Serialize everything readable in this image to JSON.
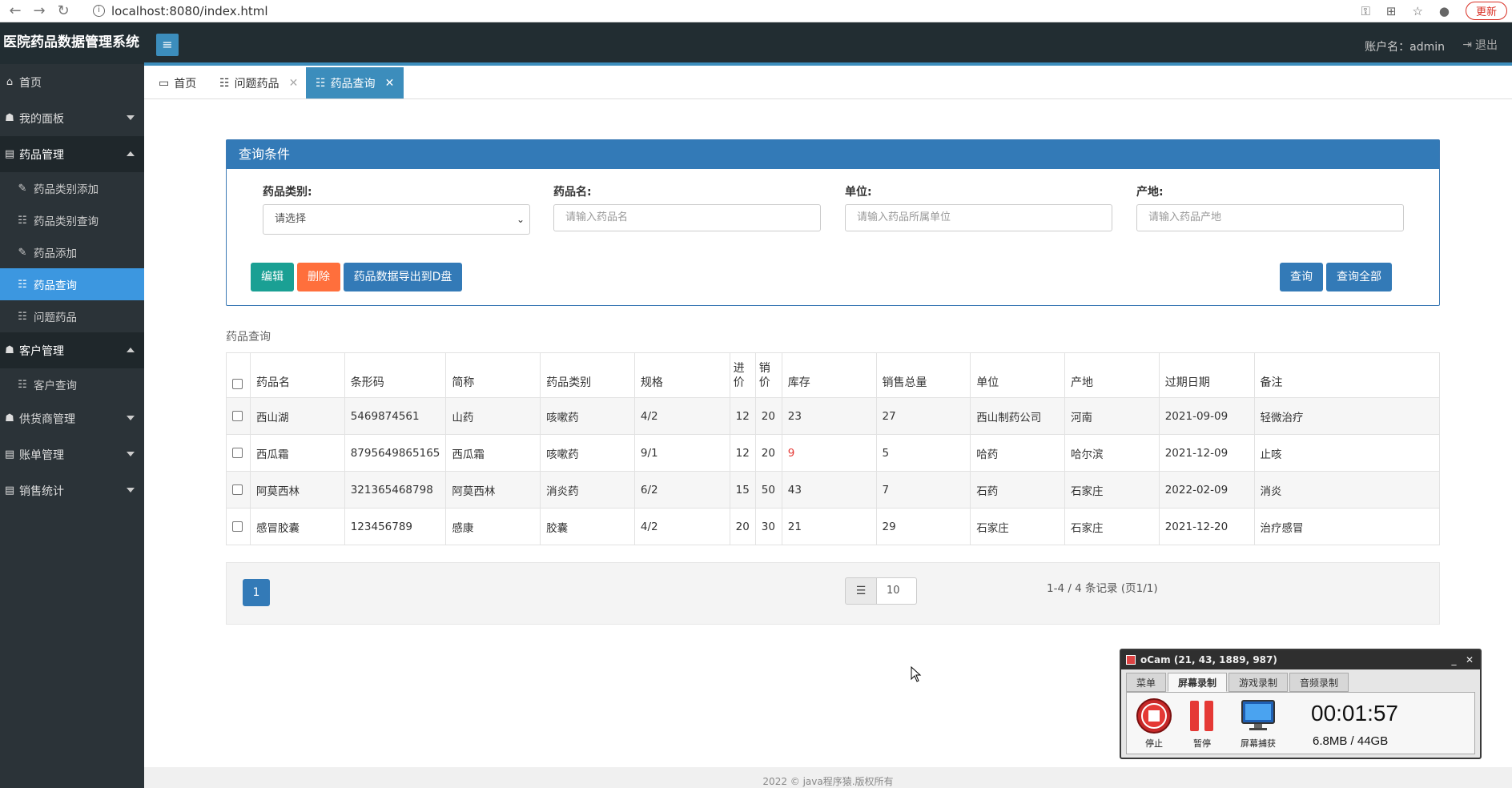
{
  "browser": {
    "url": "localhost:8080/index.html",
    "update_label": "更新"
  },
  "header": {
    "app_title": "医院药品数据管理系统",
    "toggle_icon": "≡",
    "account_label": "账户名：admin",
    "logout_label": "退出"
  },
  "sidebar": {
    "items": [
      {
        "label": "首页",
        "icon": "home-icon"
      },
      {
        "label": "我的面板",
        "icon": "user-icon"
      },
      {
        "label": "药品管理",
        "icon": "document-icon"
      },
      {
        "label": "客户管理",
        "icon": "users-icon"
      },
      {
        "label": "供货商管理",
        "icon": "users-icon"
      },
      {
        "label": "账单管理",
        "icon": "document-icon"
      },
      {
        "label": "销售统计",
        "icon": "document-icon"
      }
    ],
    "drug_sub": [
      {
        "label": "药品类别添加",
        "icon": "edit-icon"
      },
      {
        "label": "药品类别查询",
        "icon": "list-icon"
      },
      {
        "label": "药品添加",
        "icon": "edit-icon"
      },
      {
        "label": "药品查询",
        "icon": "list-icon"
      },
      {
        "label": "问题药品",
        "icon": "list-icon"
      }
    ],
    "customer_sub": [
      {
        "label": "客户查询",
        "icon": "list-icon"
      }
    ]
  },
  "tabs": [
    {
      "label": "首页"
    },
    {
      "label": "问题药品"
    },
    {
      "label": "药品查询"
    }
  ],
  "query": {
    "title": "查询条件",
    "category_label": "药品类别:",
    "category_value": "请选择",
    "name_label": "药品名:",
    "name_placeholder": "请输入药品名",
    "unit_label": "单位:",
    "unit_placeholder": "请输入药品所属单位",
    "origin_label": "产地:",
    "origin_placeholder": "请输入药品产地",
    "btn_edit": "编辑",
    "btn_delete": "删除",
    "btn_export": "药品数据导出到D盘",
    "btn_search": "查询",
    "btn_search_all": "查询全部"
  },
  "table": {
    "caption": "药品查询",
    "headers": [
      "药品名",
      "条形码",
      "简称",
      "药品类别",
      "规格",
      "进价",
      "销价",
      "库存",
      "销售总量",
      "单位",
      "产地",
      "过期日期",
      "备注"
    ],
    "rows": [
      [
        "西山湖",
        "5469874561",
        "山药",
        "咳嗽药",
        "4/2",
        "12",
        "20",
        "23",
        "27",
        "西山制药公司",
        "河南",
        "2021-09-09",
        "轻微治疗"
      ],
      [
        "西瓜霜",
        "8795649865165",
        "西瓜霜",
        "咳嗽药",
        "9/1",
        "12",
        "20",
        "9",
        "5",
        "哈药",
        "哈尔滨",
        "2021-12-09",
        "止咳"
      ],
      [
        "阿莫西林",
        "321365468798",
        "阿莫西林",
        "消炎药",
        "6/2",
        "15",
        "50",
        "43",
        "7",
        "石药",
        "石家庄",
        "2022-02-09",
        "消炎"
      ],
      [
        "感冒胶囊",
        "123456789",
        "感康",
        "胶囊",
        "4/2",
        "20",
        "30",
        "21",
        "29",
        "石家庄",
        "石家庄",
        "2021-12-20",
        "治疗感冒"
      ]
    ],
    "low_stock_color": "#e53935"
  },
  "pager": {
    "current_page": "1",
    "page_size": "10",
    "info": "1-4 / 4 条记录 (页1/1)"
  },
  "footer": {
    "text": "2022 © java程序猿.版权所有"
  },
  "ocam": {
    "title": "oCam (21, 43, 1889, 987)",
    "tabs": [
      "菜单",
      "屏幕录制",
      "游戏录制",
      "音频录制"
    ],
    "stop_label": "停止",
    "pause_label": "暂停",
    "capture_label": "屏幕捕获",
    "time": "00:01:57",
    "size": "6.8MB / 44GB"
  },
  "colors": {
    "header_bg": "#222d32",
    "sidebar_bg": "#2b3338",
    "accent": "#3c8dbc",
    "edit_btn": "#1aa094",
    "delete_btn": "#ff6f3c",
    "primary_btn": "#337ab7"
  }
}
